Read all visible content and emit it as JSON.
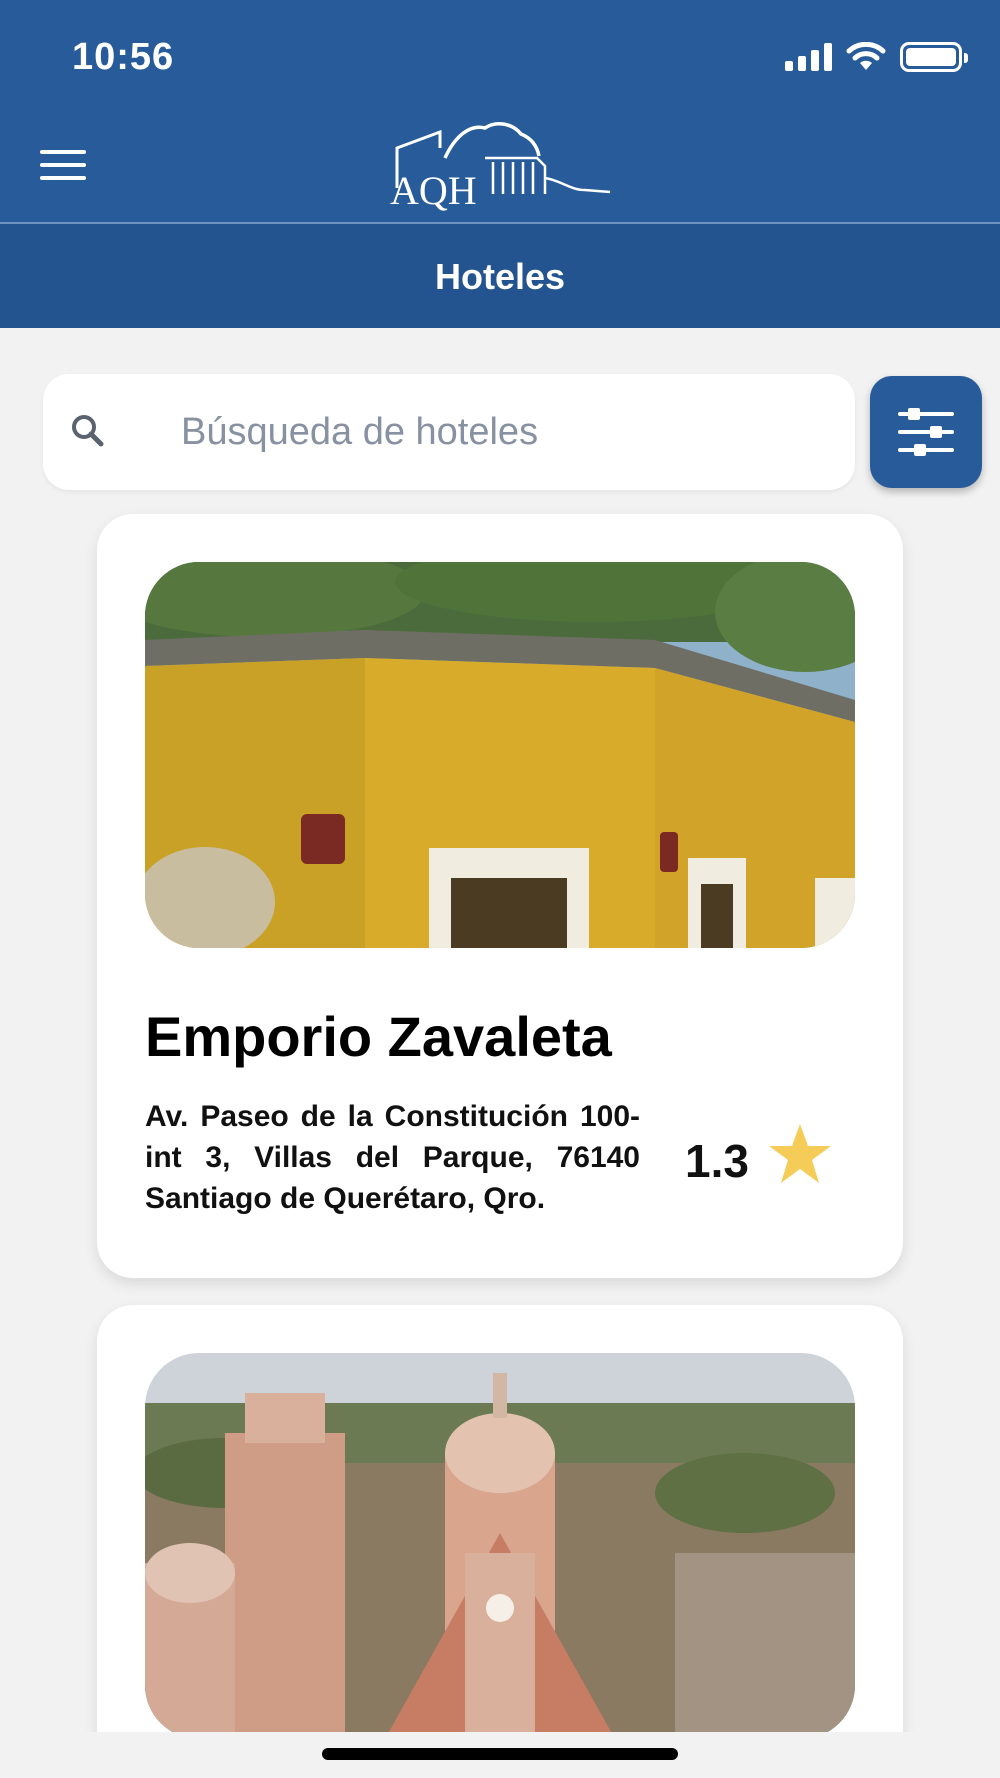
{
  "status_bar": {
    "time": "10:56"
  },
  "header": {
    "logo_text": "AQH",
    "page_title": "Hoteles",
    "brand_color": "#275b9a"
  },
  "search": {
    "placeholder": "Búsqueda de hoteles",
    "value": ""
  },
  "hotels": [
    {
      "name": "Emporio Zavaleta",
      "address": "Av. Paseo de la Constitución 100-int 3, Villas del Parque, 76140 Santiago de Querétaro, Qro.",
      "rating": "1.3",
      "rating_icon": "star-icon",
      "image_description_icon": "yellow-colonial-building-photo"
    },
    {
      "image_description_icon": "church-domes-aerial-photo"
    }
  ],
  "colors": {
    "primary": "#275b9a",
    "header_dark": "#23548f",
    "background": "#f2f2f2",
    "star": "#f5cc57"
  }
}
